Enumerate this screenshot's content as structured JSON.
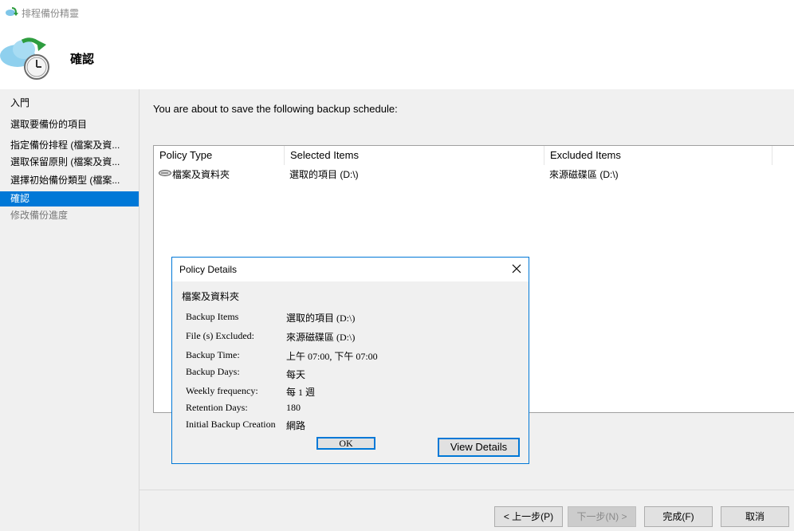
{
  "window": {
    "title": "排程備份精靈",
    "icon": "backup-wizard-icon"
  },
  "header": {
    "title": "確認",
    "icon": "cloud-clock-icon"
  },
  "nav": {
    "items": [
      {
        "label": "入門",
        "state": "normal"
      },
      {
        "label": "選取要備份的項目",
        "state": "normal"
      },
      {
        "label": "指定備份排程 (檔案及資...",
        "state": "normal"
      },
      {
        "label": "選取保留原則 (檔案及資...",
        "state": "normal"
      },
      {
        "label": "選擇初始備份類型 (檔案...",
        "state": "normal"
      },
      {
        "label": "確認",
        "state": "active"
      },
      {
        "label": "修改備份進度",
        "state": "disabled"
      }
    ]
  },
  "main": {
    "intro": "You are about to save the following backup schedule:",
    "table": {
      "columns": [
        "Policy Type",
        "Selected Items",
        "Excluded Items"
      ],
      "rows": [
        {
          "policy_type": "檔案及資料夾",
          "selected_items": "選取的項目 (D:\\)",
          "excluded_items": "來源磁碟區 (D:\\)",
          "icon": "drive-icon"
        }
      ]
    },
    "view_details_label": "View Details"
  },
  "dialog": {
    "title": "Policy Details",
    "heading": "檔案及資料夾",
    "rows": [
      {
        "label": "Backup Items",
        "value": "選取的項目 (D:\\)"
      },
      {
        "label": "File (s) Excluded:",
        "value": "來源磁碟區 (D:\\)"
      },
      {
        "label": "Backup Time:",
        "value": "上午 07:00, 下午 07:00"
      },
      {
        "label": "Backup Days:",
        "value": "每天"
      },
      {
        "label": "Weekly frequency:",
        "value": "每 1 週"
      },
      {
        "label": "Retention Days:",
        "value": "180"
      },
      {
        "label": "Initial Backup Creation",
        "value": "網路"
      }
    ],
    "ok_label": "OK"
  },
  "footer": {
    "back_label": "< 上一步(P)",
    "next_label": "下一步(N) >",
    "finish_label": "完成(F)",
    "cancel_label": "取消"
  },
  "colors": {
    "accent": "#0078d7",
    "panel": "#f0f0f0",
    "button": "#e1e1e1",
    "dialog_border": "#0078d7"
  }
}
